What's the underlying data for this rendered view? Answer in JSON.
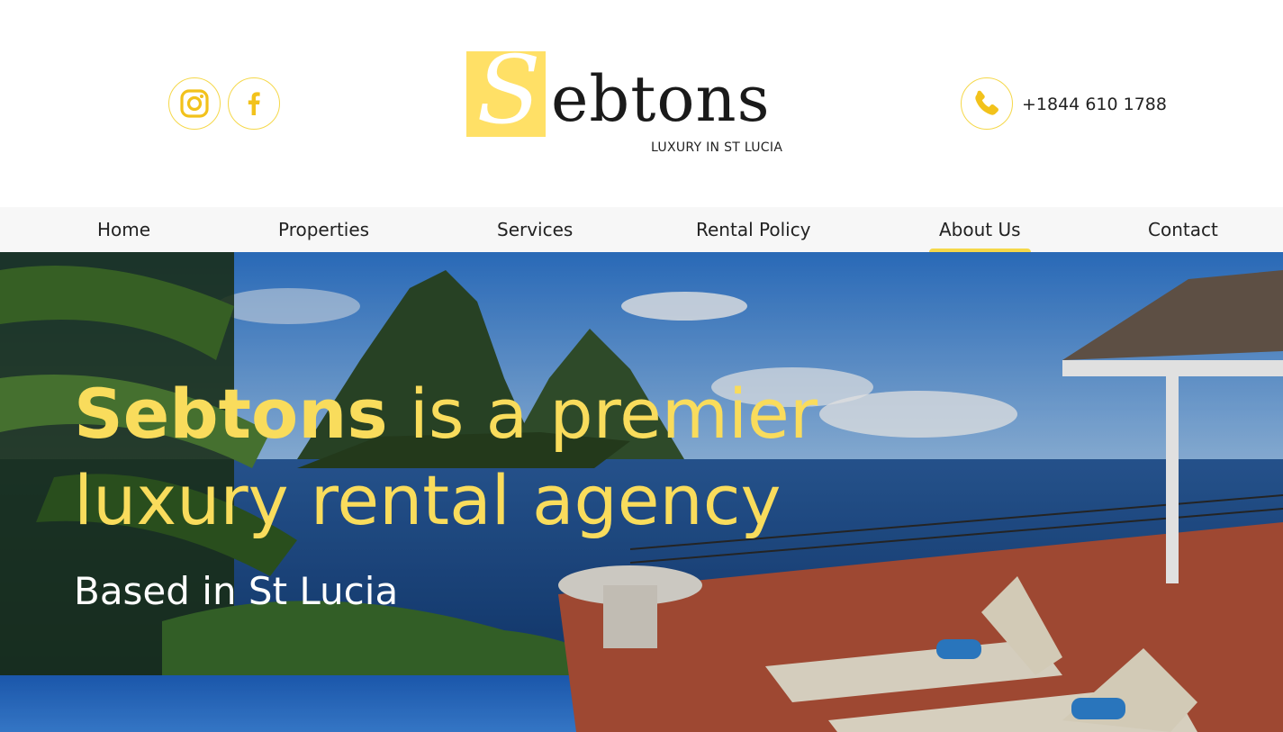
{
  "header": {
    "logo_initial": "S",
    "logo_rest": "ebtons",
    "tagline": "LUXURY IN ST LUCIA",
    "phone": "+1844 610 1788"
  },
  "social": [
    {
      "name": "instagram",
      "icon": "instagram-icon"
    },
    {
      "name": "facebook",
      "icon": "facebook-icon"
    }
  ],
  "nav": {
    "items": [
      {
        "label": "Home"
      },
      {
        "label": "Properties"
      },
      {
        "label": "Services"
      },
      {
        "label": "Rental Policy"
      },
      {
        "label": "About Us",
        "active": true
      },
      {
        "label": "Contact"
      }
    ]
  },
  "hero": {
    "title_brand": "Sebtons",
    "title_rest": " is a premier luxury rental agency",
    "subtitle": "Based in St Lucia"
  },
  "colors": {
    "accent": "#f9dc5c",
    "logo_yellow": "#ffe066",
    "nav_bg": "#f7f7f7",
    "text": "#222222"
  }
}
